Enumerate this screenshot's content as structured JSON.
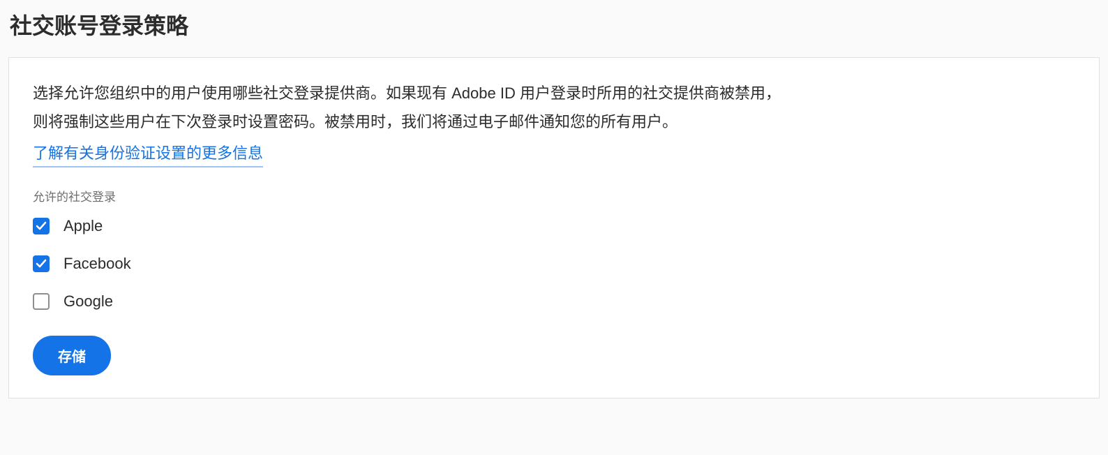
{
  "page": {
    "title": "社交账号登录策略"
  },
  "card": {
    "description_line1": "选择允许您组织中的用户使用哪些社交登录提供商。如果现有 Adobe ID 用户登录时所用的社交提供商被禁用，",
    "description_line2": "则将强制这些用户在下次登录时设置密码。被禁用时，我们将通过电子邮件通知您的所有用户。",
    "learn_more_label": "了解有关身份验证设置的更多信息",
    "section_label": "允许的社交登录",
    "options": [
      {
        "label": "Apple",
        "checked": true
      },
      {
        "label": "Facebook",
        "checked": true
      },
      {
        "label": "Google",
        "checked": false
      }
    ],
    "save_label": "存储"
  }
}
